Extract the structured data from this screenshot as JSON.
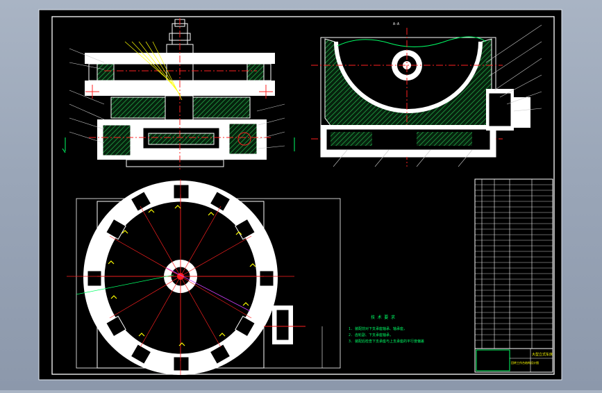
{
  "drawing": {
    "section_label": "A-A",
    "tech_requirements": {
      "title": "技 术 要 求",
      "items": [
        "1. 装配前对下支承座轴承、轴承座，",
        "2. 齿轮副、下支承座轴承，",
        "3. 装配后检查下支承座与上支承座的平行度偏差"
      ]
    },
    "title_block": {
      "name": "大型立式车床",
      "subtitle": "回转工作台结构设计图"
    },
    "colors": {
      "background": "#000000",
      "outline": "#ffffff",
      "hatch": "#1e8c3c",
      "center_line": "#ff2020",
      "annotation": "#ffff00",
      "leader": "#00ff66",
      "frame_bg": "#9aa6b8"
    }
  }
}
